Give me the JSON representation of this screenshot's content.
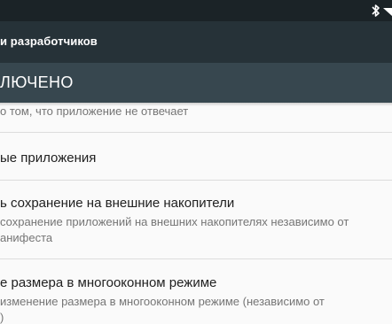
{
  "status_bar": {
    "icons": [
      "bluetooth-icon",
      "wifi-icon"
    ]
  },
  "app_bar": {
    "title": "и разработчиков"
  },
  "master_switch": {
    "label": "ЛЮЧЕНО"
  },
  "settings": [
    {
      "summary": "о том, что приложение не отвечает"
    },
    {
      "title": "ые приложения"
    },
    {
      "title": "ь сохранение на внешние накопители",
      "summary_line1": "сохранение приложений на внешних накопителях независимо от",
      "summary_line2": "анифеста"
    },
    {
      "title": "е размера в многооконном режиме",
      "summary_line1": "изменение размера в многооконном режиме (независимо от",
      "summary_line2": ")"
    }
  ],
  "colors": {
    "status_bar": "#1b2327",
    "app_bar": "#263238",
    "master_switch_bar": "#37474f",
    "background": "#fafafa"
  }
}
